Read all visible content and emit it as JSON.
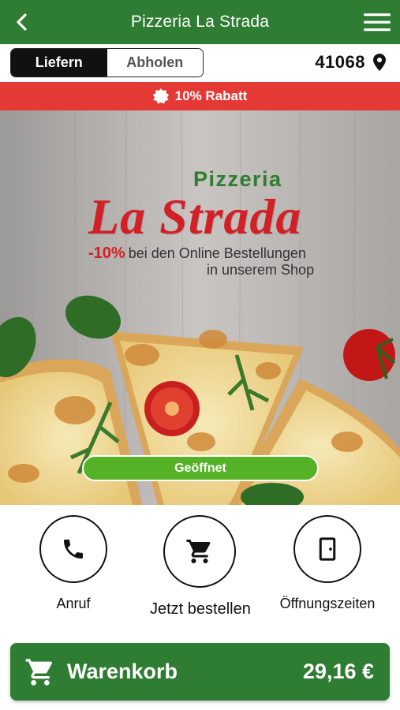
{
  "header": {
    "title": "Pizzeria La Strada",
    "back_icon": "chevron-left-icon",
    "menu_icon": "hamburger-menu-icon",
    "bg_color": "#2e7d32"
  },
  "mode": {
    "options": [
      "Liefern",
      "Abholen"
    ],
    "selected": "Liefern"
  },
  "location": {
    "postal_code": "41068",
    "icon": "location-pin-icon"
  },
  "discount": {
    "label": "10% Rabatt",
    "icon": "badge-icon",
    "bg_color": "#e53935"
  },
  "hero": {
    "brand_small": "Pizzeria",
    "brand_big": "La Strada",
    "promo_percent": "-10%",
    "promo_line1": "bei den Online Bestellungen",
    "promo_line2": "in unserem Shop",
    "status": "Geöffnet",
    "status_color": "#55b227"
  },
  "actions": [
    {
      "label": "Anruf",
      "icon": "phone-icon"
    },
    {
      "label": "Jetzt bestellen",
      "icon": "shopping-cart-icon"
    },
    {
      "label": "Öffnungszeiten",
      "icon": "door-icon"
    }
  ],
  "cart": {
    "label": "Warenkorb",
    "total": "29,16 €",
    "icon": "shopping-cart-icon"
  }
}
